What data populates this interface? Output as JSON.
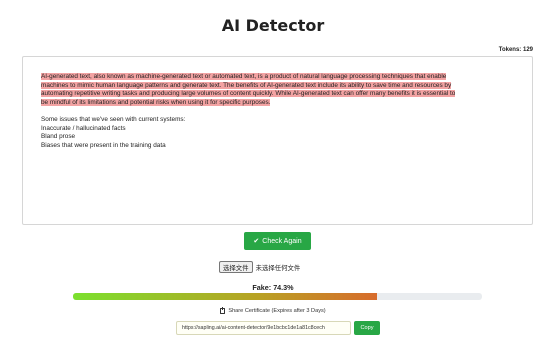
{
  "header": {
    "title": "AI Detector"
  },
  "tokens": {
    "label": "Tokens:",
    "value": "129"
  },
  "editor": {
    "highlighted_lines": [
      "AI-generated text, also known as machine-generated text or automated text, is a product of natural language processing techniques that enable",
      "machines to mimic human language patterns and generate text. The benefits of AI-generated text include its ability to save time and resources by",
      "automating repetitive writing tasks and producing large volumes of content quickly. While AI-generated text can offer many benefits it is essential to",
      "be mindful of its limitations and potential risks when using it for specific purposes."
    ],
    "plain_lines": [
      "Some issues that we've seen with current systems:",
      "Inaccurate / hallucinated facts",
      "Bland prose",
      "Biases that were present in the training data"
    ],
    "highlight_color": "#f3a3a3"
  },
  "actions": {
    "check_again": "Check Again",
    "check_icon": "checkmark-icon"
  },
  "file": {
    "button_label": "选择文件",
    "status": "未选择任何文件"
  },
  "result": {
    "label": "Fake:",
    "percent_text": "74.3%",
    "fake_score": 0.743
  },
  "share": {
    "label": "Share Certificate (Expires after 3 Days)",
    "icon": "clipboard-icon"
  },
  "certificate": {
    "url": "https://sapling.ai/ai-content-detector/9e1bcbc1de1a81c8cech",
    "copy_label": "Copy"
  },
  "colors": {
    "accent_green": "#28a745",
    "highlight": "#f3a3a3",
    "bar_track": "#e9ecef"
  }
}
